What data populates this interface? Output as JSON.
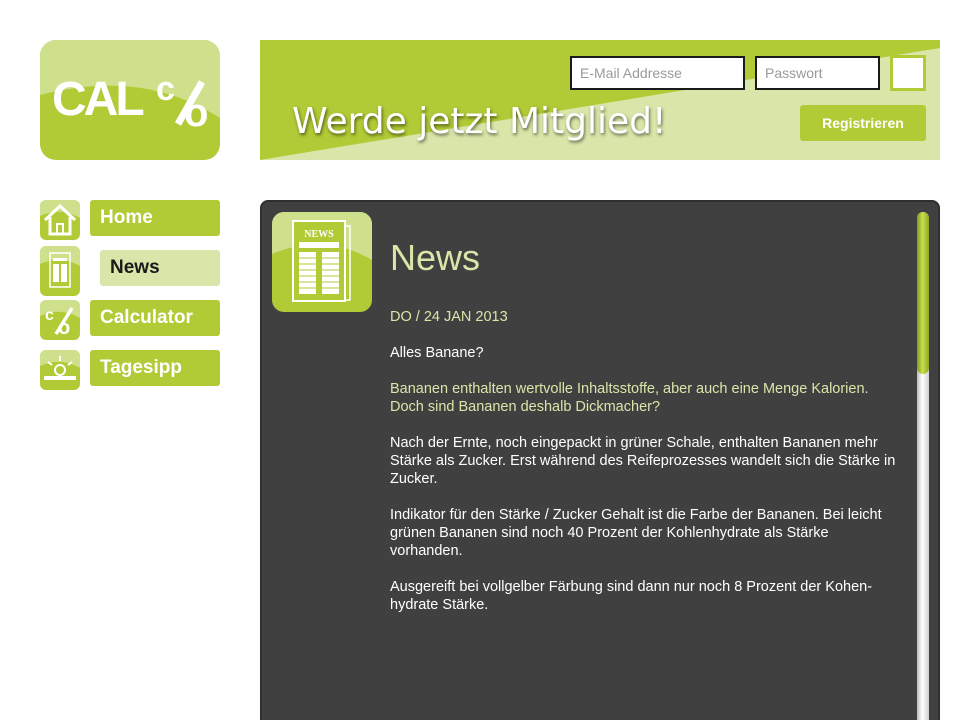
{
  "logo": {
    "text": "CAL",
    "symbol": "%"
  },
  "header": {
    "title": "Werde jetzt Mitglied!",
    "email_placeholder": "E-Mail Addresse",
    "password_placeholder": "Passwort",
    "register_label": "Registrieren"
  },
  "sidebar": {
    "items": [
      {
        "label": "Home",
        "icon": "home-icon",
        "active": false
      },
      {
        "label": "News",
        "icon": "newspaper-icon",
        "active": true
      },
      {
        "label": "Calculator",
        "icon": "percent-icon",
        "active": false
      },
      {
        "label": "Tagesipp",
        "icon": "sunrise-icon",
        "active": false
      }
    ]
  },
  "content": {
    "icon_label": "NEWS",
    "title": "News",
    "date": "DO / 24 JAN 2013",
    "headline": "Alles Banane?",
    "lead": "Bananen enthalten wertvolle Inhaltsstoffe, aber auch eine Menge Kalorien. Doch sind Bananen deshalb Dickmacher?",
    "paragraphs": [
      "Nach der Ernte, noch eingepackt in grüner Schale, enthalten Bananen mehr Stärke als Zucker. Erst während des Reifeprozesses wandelt sich die Stärke in Zucker.",
      "Indikator für den Stärke / Zucker Gehalt ist die Farbe der Bananen. Bei leicht grünen Bananen sind noch 40 Prozent der Kohlenhydrate als Stärke vorhanden.",
      "Ausgereift bei vollgelber Färbung sind dann nur noch 8 Prozent der Kohen-hydrate Stärke."
    ]
  },
  "colors": {
    "accent": "#b1cb36",
    "accent_light": "#d9e6a9",
    "panel": "#404040"
  }
}
